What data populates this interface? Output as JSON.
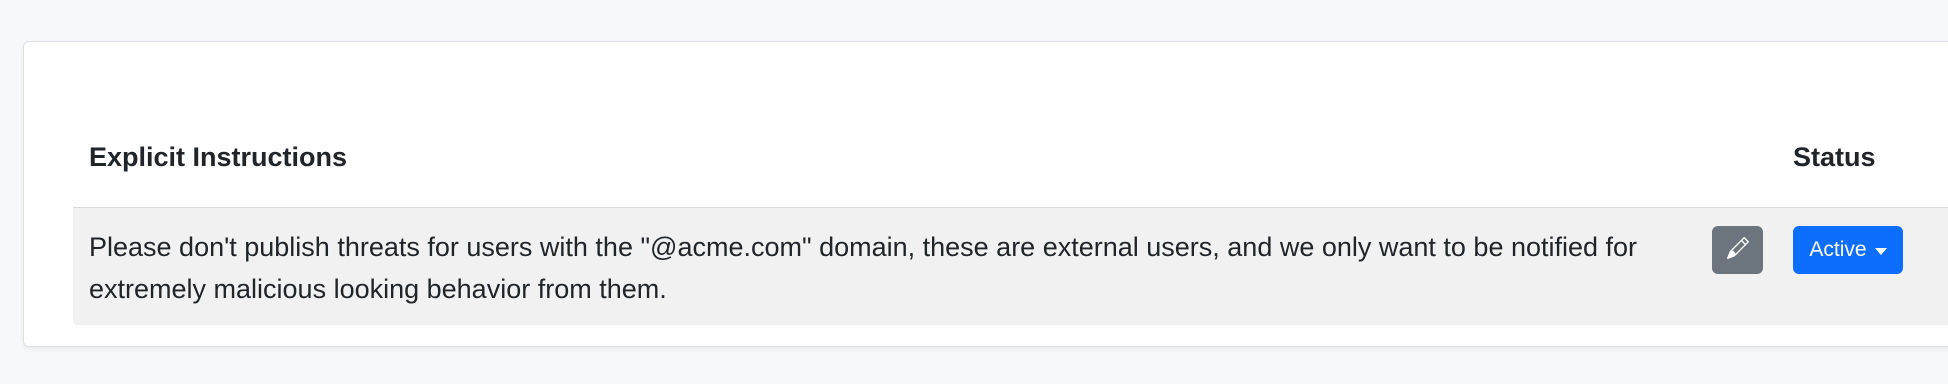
{
  "table": {
    "headers": {
      "instructions": "Explicit Instructions",
      "status": "Status"
    },
    "rows": [
      {
        "instruction": "Please don't publish threats for users with the \"@acme.com\" domain, these are external users, and we only want to be notified for extremely malicious looking behavior from them.",
        "edit_icon": "pencil-icon",
        "status_label": "Active",
        "status_icon": "caret-down-icon"
      }
    ]
  },
  "colors": {
    "edit_button": "#6c757d",
    "status_button": "#0d6efd",
    "row_background": "#f1f1f1"
  }
}
